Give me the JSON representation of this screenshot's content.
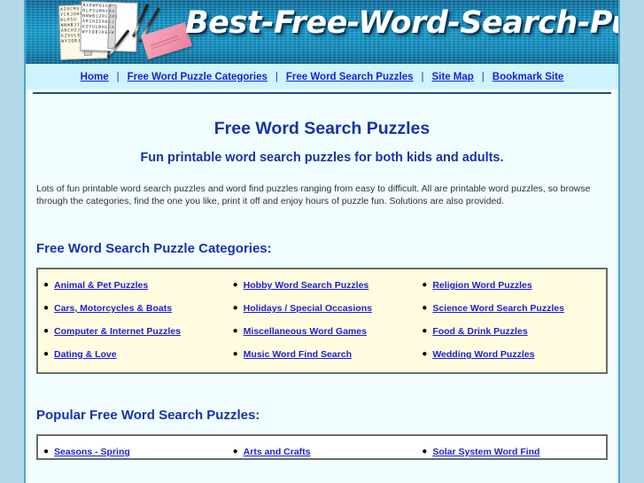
{
  "site": {
    "banner_title": "Best-Free-Word-Search-Puzzles"
  },
  "nav": {
    "separator": "|",
    "items": [
      {
        "label": "Home"
      },
      {
        "label": "Free Word Puzzle Categories"
      },
      {
        "label": "Free Word Search Puzzles"
      },
      {
        "label": "Site Map"
      },
      {
        "label": "Bookmark Site"
      }
    ]
  },
  "main": {
    "heading": "Free Word Search Puzzles",
    "subheading": "Fun printable word search puzzles for both kids and adults.",
    "intro": "Lots of fun printable word search puzzles and word find puzzles ranging from easy to difficult.   All are printable word puzzles, so browse through the categories, find the one you like, print it off and enjoy hours of puzzle fun.   Solutions are also provided.",
    "bullet_glyph": "●"
  },
  "categories": {
    "heading": "Free Word Search Puzzle Categories:",
    "rows": [
      [
        {
          "label": "Animal & Pet Puzzles"
        },
        {
          "label": "Hobby Word Search Puzzles"
        },
        {
          "label": "Religion Word Puzzles"
        }
      ],
      [
        {
          "label": "Cars, Motorcycles & Boats"
        },
        {
          "label": "Holidays / Special Occasions"
        },
        {
          "label": "Science Word Search Puzzles"
        }
      ],
      [
        {
          "label": "Computer & Internet Puzzles"
        },
        {
          "label": "Miscellaneous Word Games"
        },
        {
          "label": "Food & Drink Puzzles"
        }
      ],
      [
        {
          "label": "Dating & Love"
        },
        {
          "label": "Music Word Find Search"
        },
        {
          "label": "Wedding Word Puzzles"
        }
      ]
    ]
  },
  "popular": {
    "heading": "Popular Free Word Search Puzzles:",
    "rows": [
      [
        {
          "label": "Seasons - Spring"
        },
        {
          "label": "Arts and Crafts"
        },
        {
          "label": "Solar System Word Find"
        }
      ]
    ]
  },
  "colors": {
    "heading_blue": "#1633a8",
    "link_blue": "#1c1cd8",
    "banner_blue": "#17a3d6",
    "nav_background": "#cdf4ff",
    "box_cream": "#fffce0",
    "page_background": "#f2fdff",
    "outer_background": "#b3d9e8"
  },
  "banner_art": {
    "grid_a_letters": "AZOCMV\nYCRJOHF\nRLPSU\nNNWBJI\nARCHZJ\nKZVULE\nWYIQBJHM",
    "grid_b_letters": "RXDWPOLGZ\nRLPSUMHYAU\nNNWBJZRCZMI\nARCHZIRKSJ\nKZVULNHLGX\nWYIQBJHESW"
  }
}
